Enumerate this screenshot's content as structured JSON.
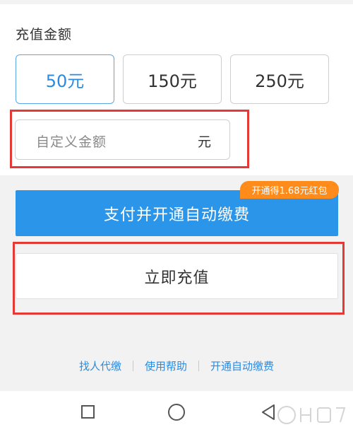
{
  "recharge": {
    "section_title": "充值金额",
    "amounts": [
      "50元",
      "150元",
      "250元"
    ],
    "selected_index": 0,
    "custom_placeholder": "自定义金额",
    "custom_unit": "元"
  },
  "actions": {
    "pay_auto_label": "支付并开通自动缴费",
    "promo_badge": "开通得1.68元红包",
    "recharge_now_label": "立即充值"
  },
  "footer_links": [
    "找人代缴",
    "使用帮助",
    "开通自动缴费"
  ],
  "nav": {
    "icons": [
      "recent-apps-icon",
      "home-icon",
      "back-icon"
    ]
  },
  "colors": {
    "accent": "#2b95ea",
    "selected_text": "#2a8be0",
    "promo": "#ff8b1a",
    "highlight_box": "#e53935"
  }
}
